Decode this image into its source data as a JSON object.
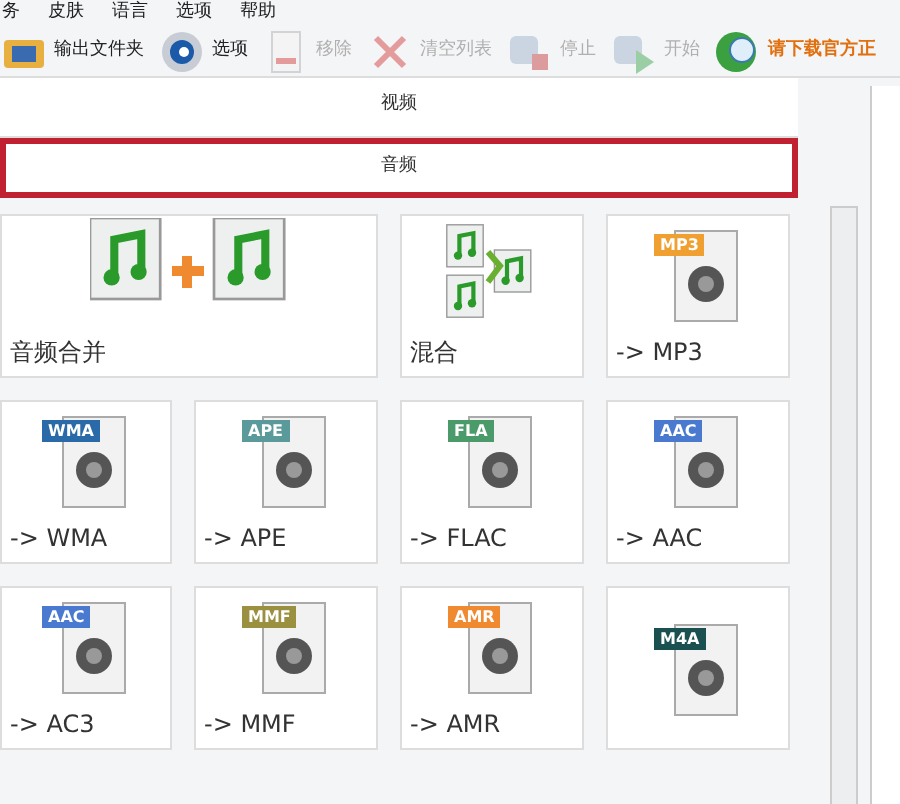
{
  "menu": [
    "务",
    "皮肤",
    "语言",
    "选项",
    "帮助"
  ],
  "toolbar": [
    {
      "kind": "folder",
      "label": "输出文件夹",
      "disabled": false
    },
    {
      "kind": "gear",
      "label": "选项",
      "disabled": false
    },
    {
      "kind": "remove",
      "label": "移除",
      "disabled": true
    },
    {
      "kind": "clear",
      "label": "清空列表",
      "disabled": true
    },
    {
      "kind": "stop",
      "label": "停止",
      "disabled": true
    },
    {
      "kind": "start",
      "label": "开始",
      "disabled": true
    },
    {
      "kind": "globe",
      "label": "请下载官方正",
      "disabled": false
    }
  ],
  "categories": [
    {
      "label": "视频",
      "selected": false
    },
    {
      "label": "音频",
      "selected": true
    }
  ],
  "tiles": [
    {
      "kind": "merge",
      "label": "音频合并"
    },
    {
      "kind": "mix",
      "label": "混合"
    },
    {
      "kind": "convert",
      "badge": "MP3",
      "color": "#f0a030",
      "label": "-> MP3"
    },
    {
      "kind": "convert",
      "badge": "WMA",
      "color": "#2a6aa8",
      "label": "-> WMA"
    },
    {
      "kind": "convert",
      "badge": "APE",
      "color": "#5a9a9a",
      "label": "-> APE"
    },
    {
      "kind": "convert",
      "badge": "FLA",
      "color": "#4a9a6a",
      "label": "-> FLAC"
    },
    {
      "kind": "convert",
      "badge": "AAC",
      "color": "#4a7ad0",
      "label": "-> AAC"
    },
    {
      "kind": "convert",
      "badge": "AAC",
      "color": "#4a7ad0",
      "label": "-> AC3"
    },
    {
      "kind": "convert",
      "badge": "MMF",
      "color": "#9a9040",
      "label": "-> MMF"
    },
    {
      "kind": "convert",
      "badge": "AMR",
      "color": "#f08a30",
      "label": "-> AMR"
    },
    {
      "kind": "convert",
      "badge": "M4A",
      "color": "#1a5050"
    }
  ]
}
